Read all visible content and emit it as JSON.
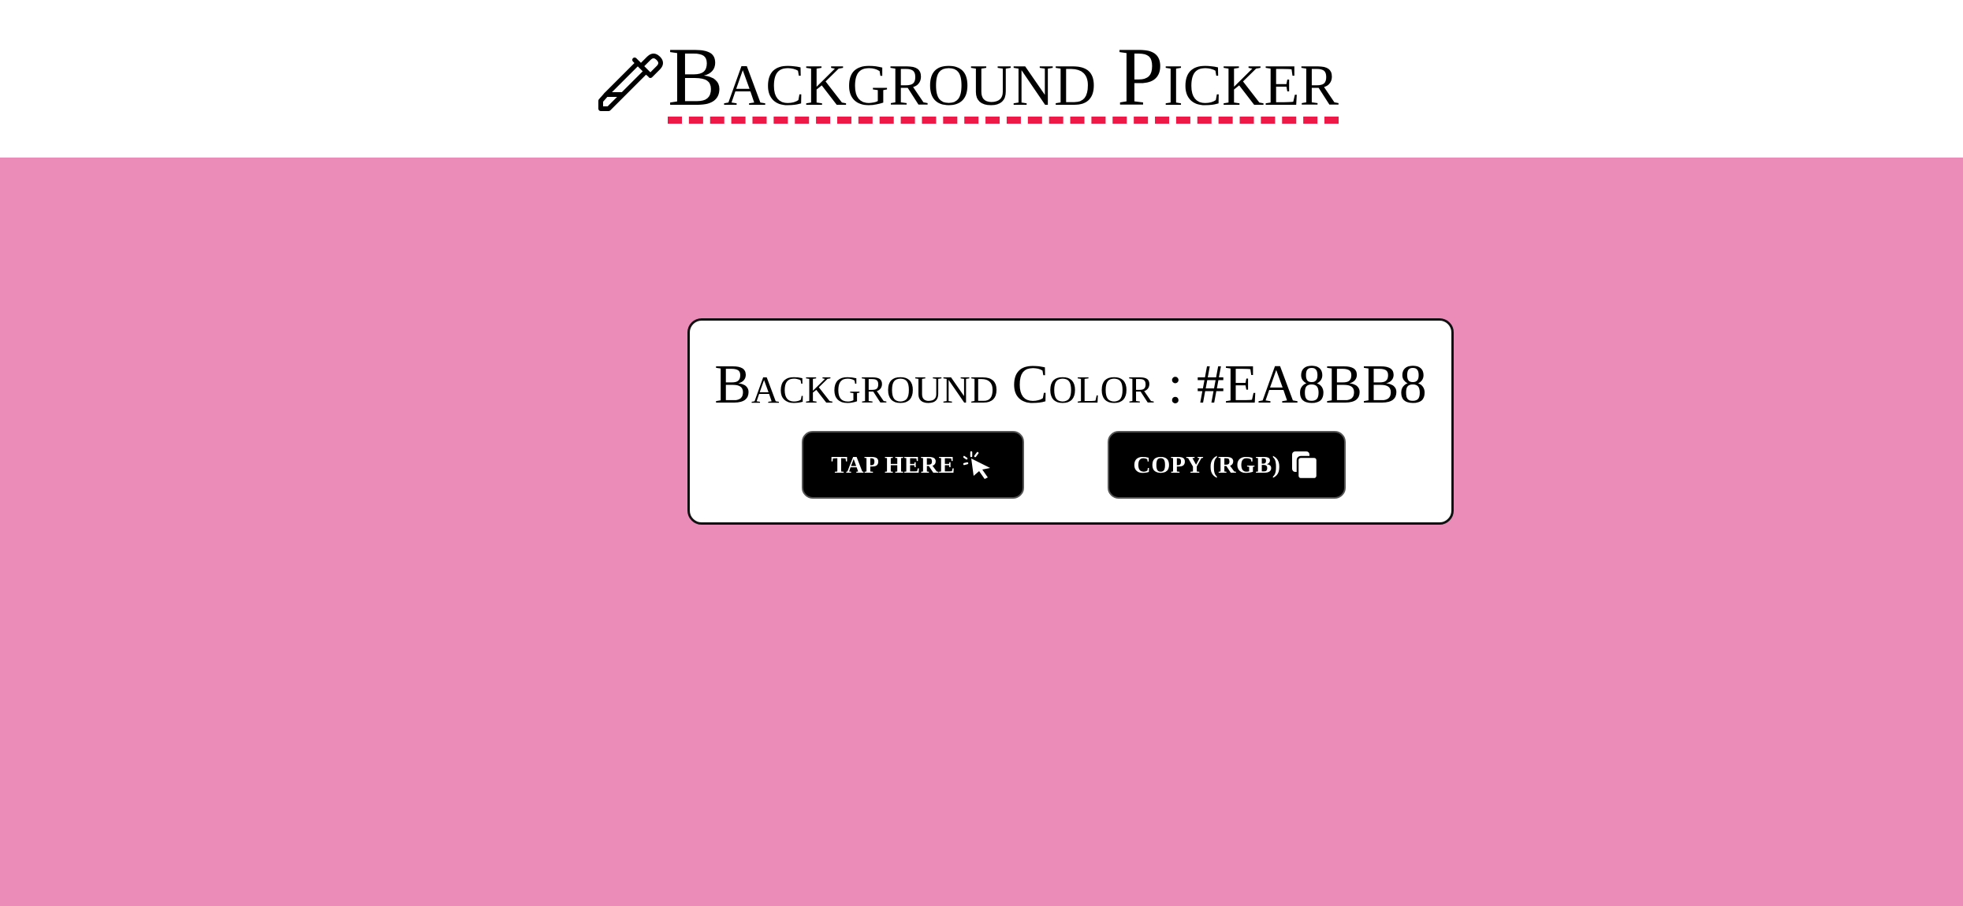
{
  "header": {
    "title": "Background Picker",
    "icon": "eyedropper-icon",
    "underline_color": "#ee1946"
  },
  "background": {
    "color": "#EA8BB8"
  },
  "card": {
    "label": "Background Color",
    "separator": " : ",
    "hex_value": "#EA8BB8"
  },
  "buttons": {
    "tap_label": "TAP HERE",
    "tap_icon": "pointer-click-icon",
    "copy_label": "COPY (RGB)",
    "copy_icon": "copy-icon"
  }
}
